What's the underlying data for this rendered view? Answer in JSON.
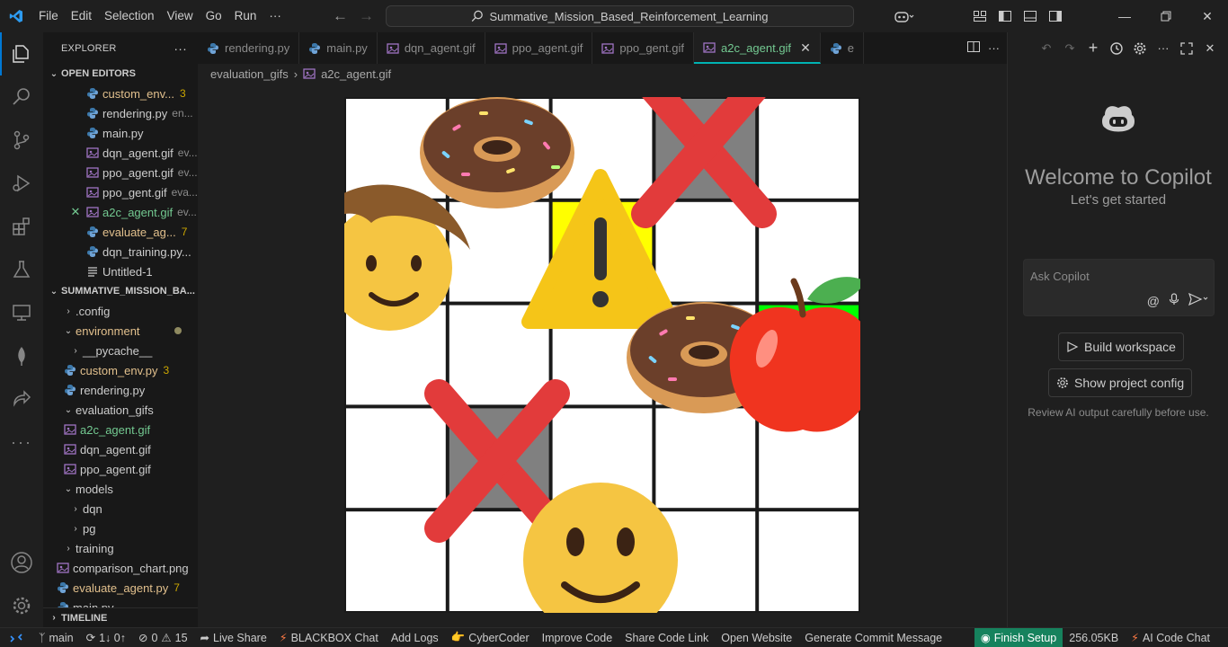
{
  "titlebar": {
    "menus": [
      "File",
      "Edit",
      "Selection",
      "View",
      "Go",
      "Run",
      "···"
    ],
    "search": "Summative_Mission_Based_Reinforcement_Learning"
  },
  "explorer": {
    "title": "EXPLORER",
    "more": "···",
    "open_editors_title": "OPEN EDITORS",
    "open_editors": [
      {
        "name": "custom_env...",
        "hint": "",
        "badge": "3",
        "state": "modified"
      },
      {
        "name": "rendering.py",
        "hint": "en...",
        "badge": "",
        "state": "normal"
      },
      {
        "name": "main.py",
        "hint": "",
        "badge": "",
        "state": "normal"
      },
      {
        "name": "dqn_agent.gif",
        "hint": "ev...",
        "badge": "",
        "state": "normal"
      },
      {
        "name": "ppo_agent.gif",
        "hint": "ev...",
        "badge": "",
        "state": "normal"
      },
      {
        "name": "ppo_gent.gif",
        "hint": "eva...",
        "badge": "",
        "state": "normal"
      },
      {
        "name": "a2c_agent.gif",
        "hint": "ev...",
        "badge": "",
        "state": "active"
      },
      {
        "name": "evaluate_ag...",
        "hint": "",
        "badge": "7",
        "state": "modified"
      },
      {
        "name": "dqn_training.py...",
        "hint": "",
        "badge": "",
        "state": "normal"
      },
      {
        "name": "Untitled-1",
        "hint": "",
        "badge": "",
        "state": "normal"
      }
    ],
    "project_title": "SUMMATIVE_MISSION_BA...",
    "tree": [
      {
        "name": ".config",
        "badge": ""
      },
      {
        "name": "environment",
        "badge": ""
      },
      {
        "name": "__pycache__",
        "badge": ""
      },
      {
        "name": "custom_env.py",
        "badge": "3"
      },
      {
        "name": "rendering.py",
        "badge": ""
      },
      {
        "name": "evaluation_gifs",
        "badge": ""
      },
      {
        "name": "a2c_agent.gif",
        "badge": ""
      },
      {
        "name": "dqn_agent.gif",
        "badge": ""
      },
      {
        "name": "ppo_agent.gif",
        "badge": ""
      },
      {
        "name": "models",
        "badge": ""
      },
      {
        "name": "dqn",
        "badge": ""
      },
      {
        "name": "pg",
        "badge": ""
      },
      {
        "name": "training",
        "badge": ""
      },
      {
        "name": "comparison_chart.png",
        "badge": ""
      },
      {
        "name": "evaluate_agent.py",
        "badge": "7"
      },
      {
        "name": "main.py",
        "badge": ""
      }
    ],
    "timeline_title": "TIMELINE"
  },
  "tabs": [
    {
      "label": "rendering.py",
      "kind": "py"
    },
    {
      "label": "main.py",
      "kind": "py"
    },
    {
      "label": "dqn_agent.gif",
      "kind": "gif"
    },
    {
      "label": "ppo_agent.gif",
      "kind": "gif"
    },
    {
      "label": "ppo_gent.gif",
      "kind": "gif"
    },
    {
      "label": "a2c_agent.gif",
      "kind": "gif",
      "active": true
    },
    {
      "label": "e",
      "kind": "py"
    }
  ],
  "breadcrumb": {
    "folder": "evaluation_gifs",
    "file": "a2c_agent.gif"
  },
  "copilot": {
    "welcome": "Welcome to Copilot",
    "subtitle": "Let's get started",
    "input_placeholder": "Ask Copilot",
    "build_workspace": "Build workspace",
    "show_project_config": "Show project config",
    "note": "Review AI output carefully before use."
  },
  "statusbar": {
    "branch": "main",
    "sync": "1↓ 0↑",
    "errors": "0",
    "warnings": "15",
    "items": [
      "Live Share",
      "BLACKBOX Chat",
      "Add Logs",
      "CyberCoder",
      "Improve Code",
      "Share Code Link",
      "Open Website",
      "Generate Commit Message"
    ],
    "finish_setup": "Finish Setup",
    "file_size": "256.05KB",
    "ai_chat": "AI Code Chat"
  },
  "grid": {
    "rows": 5,
    "cols": 5,
    "cell_colors": [
      [
        "#ffffff",
        "#ffffff",
        "#ffffff",
        "#808080",
        "#ffffff"
      ],
      [
        "#ffffff",
        "#ffffff",
        "#ffff00",
        "#ffffff",
        "#ffffff"
      ],
      [
        "#ffffff",
        "#ffffff",
        "#ffffff",
        "#ffffff",
        "#00ff00"
      ],
      [
        "#ffffff",
        "#808080",
        "#ffffff",
        "#ffffff",
        "#ffffff"
      ],
      [
        "#ffffff",
        "#ffffff",
        "#ffffff",
        "#ffffff",
        "#ffffff"
      ]
    ],
    "sprites": [
      "donut",
      "obstacle-x",
      "warning-sign",
      "boy-face",
      "donut",
      "apple",
      "obstacle-x",
      "smiley-face"
    ]
  },
  "colors": {
    "accent": "#0078d4",
    "tab_underline": "#00b3b3",
    "modified": "#e2c08d",
    "active_file": "#73c991",
    "status_highlight": "#16825d"
  }
}
